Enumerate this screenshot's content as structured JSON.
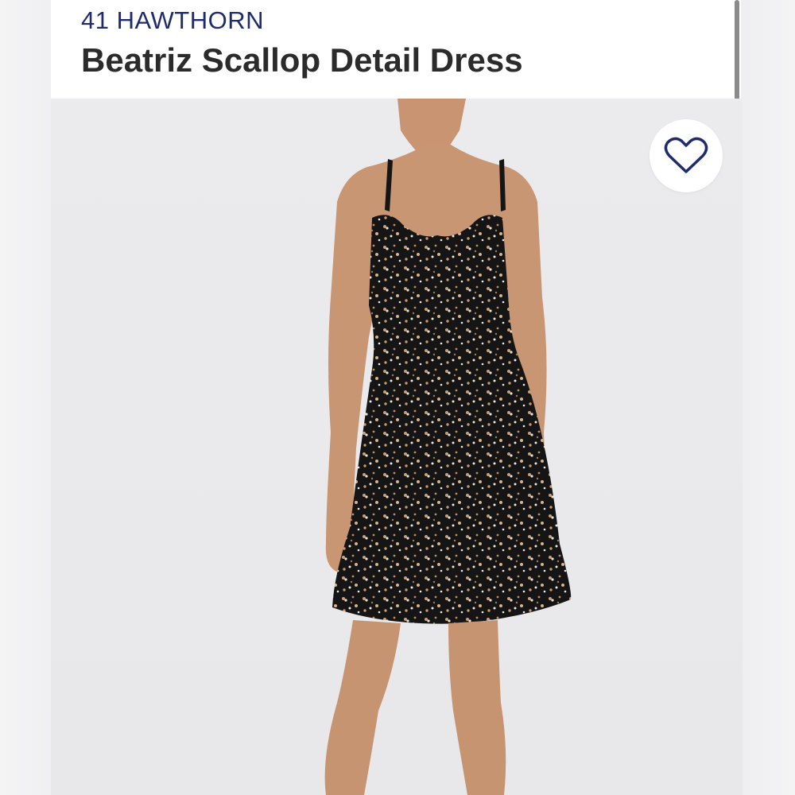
{
  "product": {
    "brand": "41 HAWTHORN",
    "title": "Beatriz Scallop Detail Dress"
  },
  "icons": {
    "favorite": "heart-outline-icon"
  },
  "colors": {
    "brand_text": "#1f2c6b",
    "title_text": "#2b2b2b",
    "dress_base": "#151515"
  }
}
